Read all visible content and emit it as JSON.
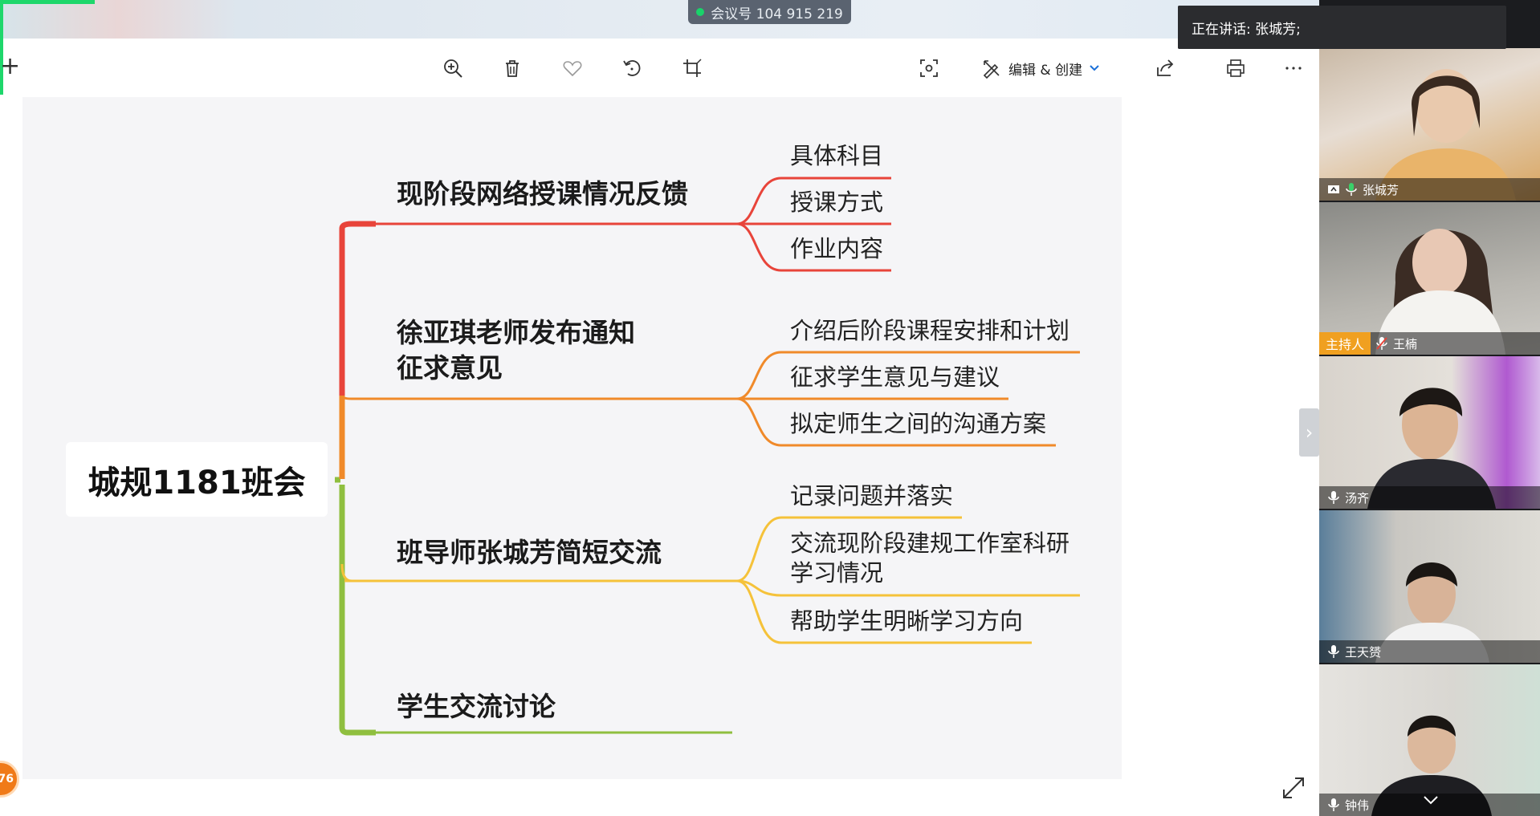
{
  "meeting": {
    "id_label": "会议号 104 915 219"
  },
  "speaking": {
    "text": "正在讲话: 张城芳;"
  },
  "toolbar": {
    "edit_create": "编辑 & 创建"
  },
  "mindmap": {
    "root": "城规1181班会",
    "branches": [
      {
        "title": "现阶段网络授课情况反馈",
        "color": "#e8443a",
        "leaves": [
          "具体科目",
          "授课方式",
          "作业内容"
        ]
      },
      {
        "title_line1": "徐亚琪老师发布通知",
        "title_line2": "征求意见",
        "color": "#f08a2a",
        "leaves": [
          "介绍后阶段课程安排和计划",
          "征求学生意见与建议",
          "拟定师生之间的沟通方案"
        ]
      },
      {
        "title": "班导师张城芳简短交流",
        "color": "#f5c23a",
        "leaves": [
          "记录问题并落实",
          "交流现阶段建规工作室科研",
          "学习情况",
          "帮助学生明晰学习方向"
        ]
      },
      {
        "title": "学生交流讨论",
        "color": "#8fbf3f"
      }
    ]
  },
  "participants": [
    {
      "name": "张城芳"
    },
    {
      "name": "王楠",
      "role": "主持人"
    },
    {
      "name": "汤齐"
    },
    {
      "name": "王天赟"
    },
    {
      "name": "钟伟"
    }
  ],
  "badge": {
    "count": "76"
  }
}
